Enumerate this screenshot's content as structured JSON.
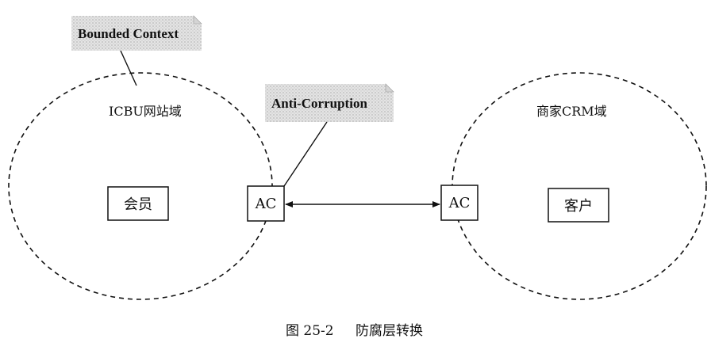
{
  "notes": {
    "bounded_context": "Bounded Context",
    "anti_corruption": "Anti-Corruption"
  },
  "left_domain": {
    "title": "ICBU网站域",
    "entity": "会员",
    "adapter": "AC"
  },
  "right_domain": {
    "title": "商家CRM域",
    "entity": "客户",
    "adapter": "AC"
  },
  "caption": {
    "figure_number": "图 25-2",
    "title": "防腐层转换"
  }
}
